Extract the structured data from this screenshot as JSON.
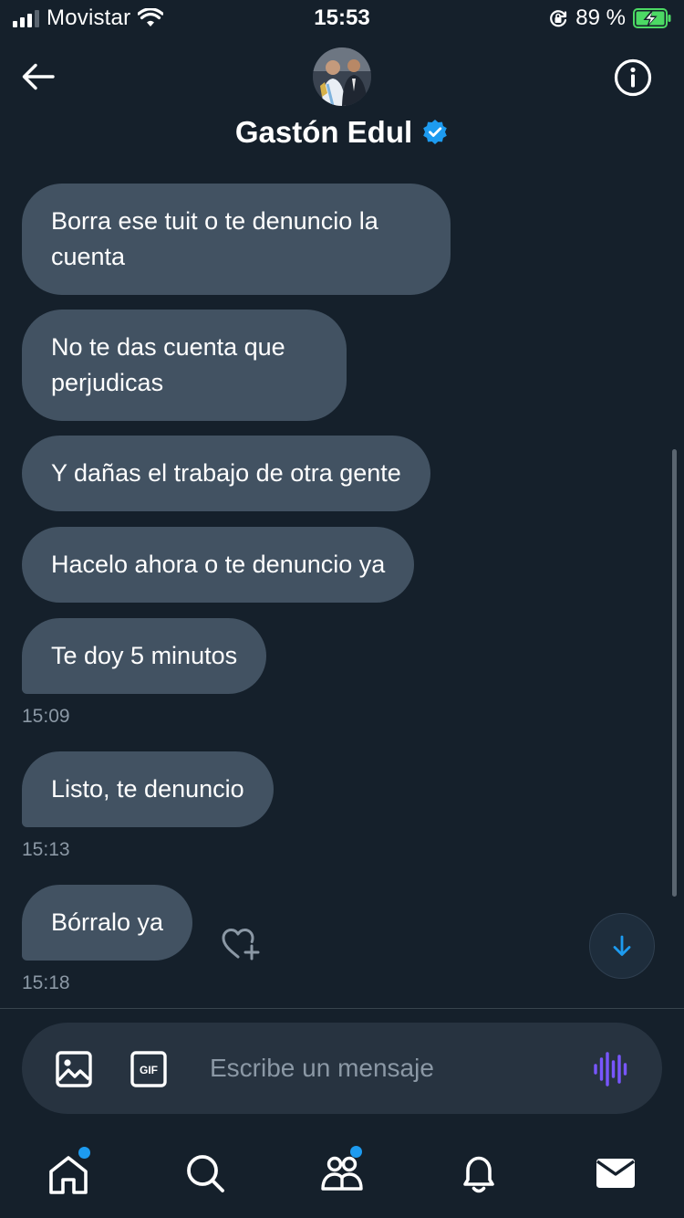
{
  "status_bar": {
    "carrier": "Movistar",
    "time": "15:53",
    "battery_percent": "89 %",
    "signal_level": 3,
    "battery_level": 0.89
  },
  "header": {
    "contact_name": "Gastón Edul",
    "verified": true
  },
  "messages": [
    {
      "text": "Borra ese tuit o te denuncio la cuenta"
    },
    {
      "text": "No te das cuenta que perjudicas"
    },
    {
      "text": "Y dañas el trabajo de otra gente"
    },
    {
      "text": "Hacelo ahora o te denuncio ya"
    },
    {
      "text": "Te doy 5 minutos",
      "time": "15:09"
    },
    {
      "text": "Listo, te denuncio",
      "time": "15:13"
    },
    {
      "text": "Bórralo ya",
      "time": "15:18"
    }
  ],
  "composer": {
    "placeholder": "Escribe un mensaje",
    "gif_label": "GIF"
  },
  "tabbar": {
    "items": [
      {
        "icon": "home-icon",
        "unread_dot": true
      },
      {
        "icon": "search-icon",
        "unread_dot": false
      },
      {
        "icon": "communities-icon",
        "unread_dot": true
      },
      {
        "icon": "notifications-icon",
        "unread_dot": false
      },
      {
        "icon": "messages-icon",
        "unread_dot": false,
        "active": true
      }
    ]
  },
  "colors": {
    "background": "#15202b",
    "bubble": "#425262",
    "accent": "#1d9bf0",
    "battery_green": "#4cd964",
    "voice_purple": "#7856ff",
    "muted_text": "#8b98a5"
  }
}
